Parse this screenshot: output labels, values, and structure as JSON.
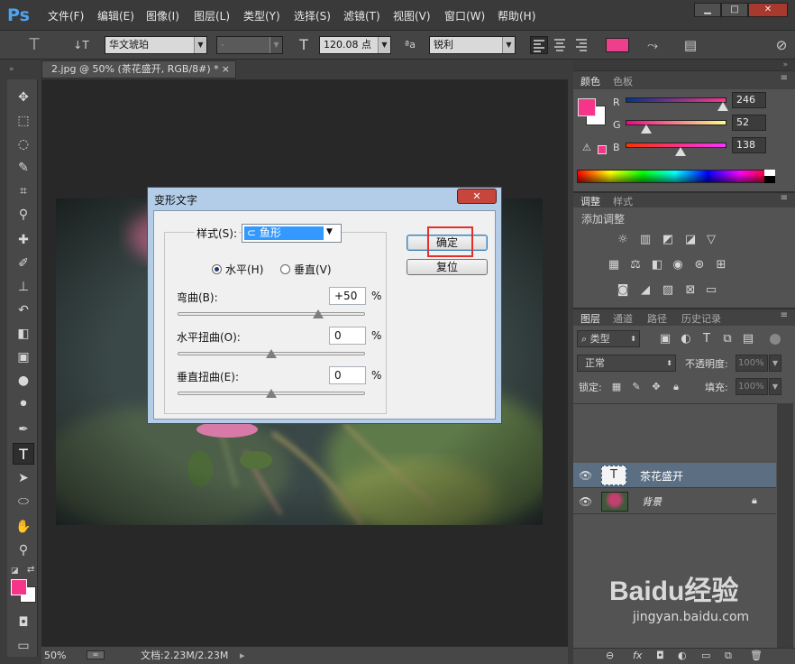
{
  "app": {
    "logo": "Ps"
  },
  "menu": [
    "文件(F)",
    "编辑(E)",
    "图像(I)",
    "图层(L)",
    "类型(Y)",
    "选择(S)",
    "滤镜(T)",
    "视图(V)",
    "窗口(W)",
    "帮助(H)"
  ],
  "window_controls": {
    "minimize": "▁",
    "maximize": "□",
    "close": "✕"
  },
  "options": {
    "tool_icon": "T",
    "orient_icon": "↓T",
    "font_family": "华文琥珀",
    "font_style": "-",
    "size_icon": "T",
    "font_size": "120.08 点",
    "aa_icon": "ªa",
    "antialias": "锐利",
    "text_color": "#ee3f8c"
  },
  "document": {
    "tab_title": "2.jpg @ 50% (茶花盛开, RGB/8#) *",
    "close_icon": "×",
    "zoom": "50%",
    "doc_info": "文档:2.23M/2.23M"
  },
  "tools": [
    "move-icon",
    "marquee-icon",
    "lasso-icon",
    "quick-select-icon",
    "crop-icon",
    "eyedropper-icon",
    "healing-icon",
    "brush-icon",
    "stamp-icon",
    "history-brush-icon",
    "eraser-icon",
    "gradient-icon",
    "blur-icon",
    "dodge-icon",
    "pen-icon",
    "type-icon",
    "path-select-icon",
    "ellipse-icon",
    "hand-icon",
    "zoom-icon"
  ],
  "dialog": {
    "title": "变形文字",
    "close": "✕",
    "style_label": "样式(S):",
    "style_value": "鱼形",
    "horizontal_label": "水平(H)",
    "vertical_label": "垂直(V)",
    "bend_label": "弯曲(B):",
    "bend_value": "+50",
    "hdist_label": "水平扭曲(O):",
    "hdist_value": "0",
    "vdist_label": "垂直扭曲(E):",
    "vdist_value": "0",
    "percent": "%",
    "ok": "确定",
    "reset": "复位",
    "bend": 50,
    "hdist": 0,
    "vdist": 0
  },
  "color_panel": {
    "tabs": [
      "颜色",
      "色板"
    ],
    "channels": [
      {
        "name": "R",
        "value": "246"
      },
      {
        "name": "G",
        "value": "52"
      },
      {
        "name": "B",
        "value": "138"
      }
    ],
    "foreground": "#f6348a",
    "background": "#ffffff"
  },
  "adjust_panel": {
    "tabs": [
      "调整",
      "样式"
    ],
    "title": "添加调整"
  },
  "layers_panel": {
    "tabs": [
      "图层",
      "通道",
      "路径",
      "历史记录"
    ],
    "filter": "类型",
    "blend_mode": "正常",
    "opacity_label": "不透明度:",
    "opacity": "100%",
    "lock_label": "锁定:",
    "fill_label": "填充:",
    "fill": "100%",
    "layers": [
      {
        "name": "茶花盛开",
        "thumb": "T",
        "selected": true
      },
      {
        "name": "背景",
        "thumb": "",
        "selected": false
      }
    ]
  },
  "watermark": {
    "brand": "Baidu经验",
    "url": "jingyan.baidu.com"
  }
}
